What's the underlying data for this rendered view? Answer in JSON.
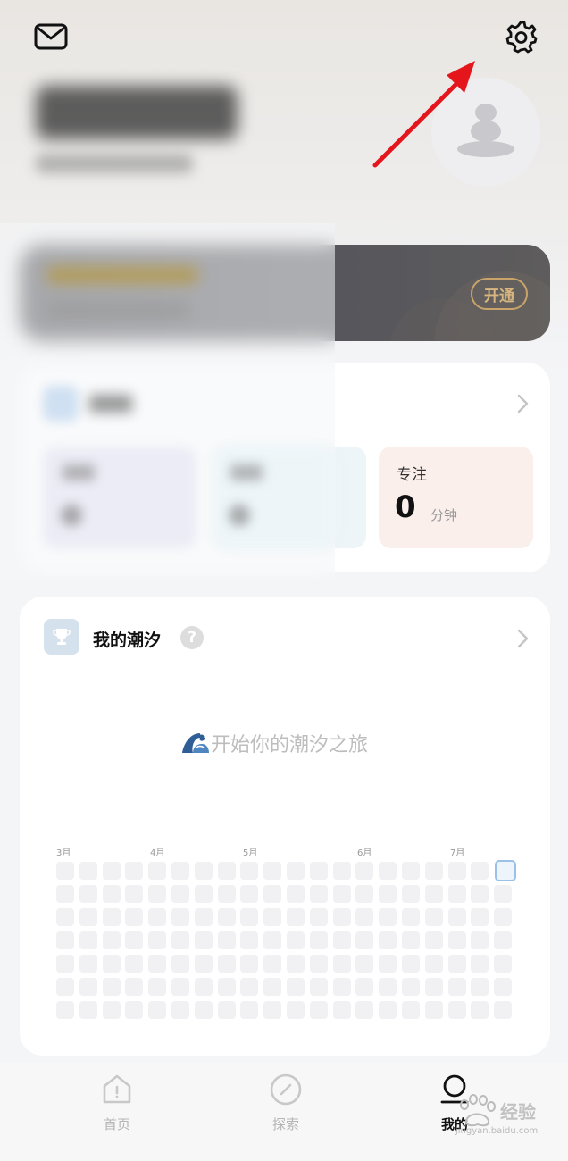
{
  "header": {
    "mail_icon": "mail-icon",
    "settings_icon": "gear-icon",
    "avatar_icon": "avatar-placeholder-icon"
  },
  "vip": {
    "button_label": "开通",
    "accent_color": "#c9a46a"
  },
  "stats": {
    "focus_label": "专注",
    "focus_value": "0",
    "focus_unit": "分钟"
  },
  "tide": {
    "title": "我的潮汐",
    "help_icon": "?",
    "empty_text": "开始你的潮汐之旅",
    "months": [
      "3月",
      "4月",
      "5月",
      "6月",
      "7月"
    ],
    "grid_columns": 20,
    "grid_rows": 7
  },
  "nav": {
    "items": [
      {
        "label": "首页",
        "icon": "home-icon"
      },
      {
        "label": "探索",
        "icon": "compass-icon"
      },
      {
        "label": "我的",
        "icon": "profile-icon"
      }
    ]
  },
  "watermark": {
    "text": "经验",
    "url": "jingyan.baidu.com"
  },
  "annotation": {
    "arrow_color": "#e5151c"
  }
}
